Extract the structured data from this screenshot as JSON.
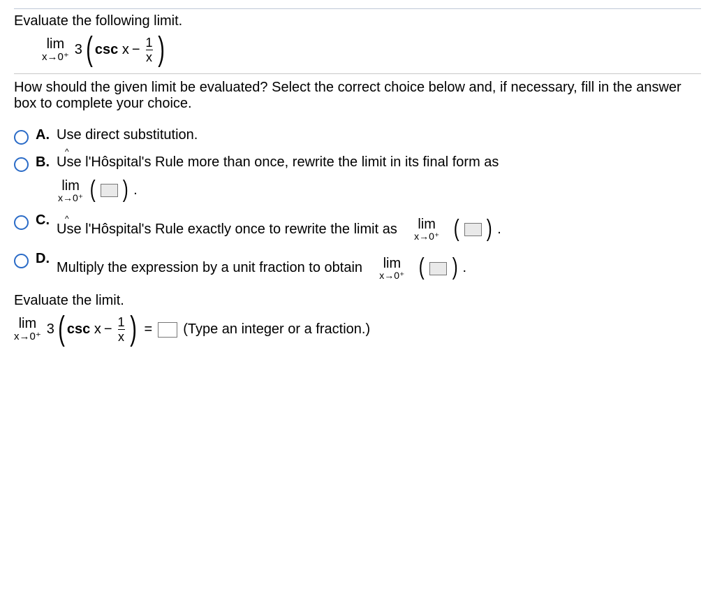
{
  "title": "Evaluate the following limit.",
  "limit": {
    "lim": "lim",
    "approach": "x→0⁺",
    "coef": "3",
    "csc": "csc",
    "var": "x",
    "minus": "−",
    "fracNum": "1",
    "fracDen": "x"
  },
  "question": "How should the given limit be evaluated? Select the correct choice below and, if necessary, fill in the answer box to complete your choice.",
  "opts": {
    "A": {
      "label": "A.",
      "text": "Use direct substitution."
    },
    "B": {
      "label": "B.",
      "text": "Use l'Hôspital's Rule more than once, rewrite the limit in its final form as",
      "lim": "lim",
      "approach": "x→0⁺",
      "period": "."
    },
    "C": {
      "label": "C.",
      "text": "Use l'Hôspital's Rule exactly once to rewrite the limit as",
      "lim": "lim",
      "approach": "x→0⁺",
      "period": "."
    },
    "D": {
      "label": "D.",
      "text": "Multiply the expression by a unit fraction to obtain",
      "lim": "lim",
      "approach": "x→0⁺",
      "period": "."
    }
  },
  "eval": {
    "heading": "Evaluate the limit.",
    "eq": "=",
    "hint": "(Type an integer or a fraction.)"
  }
}
